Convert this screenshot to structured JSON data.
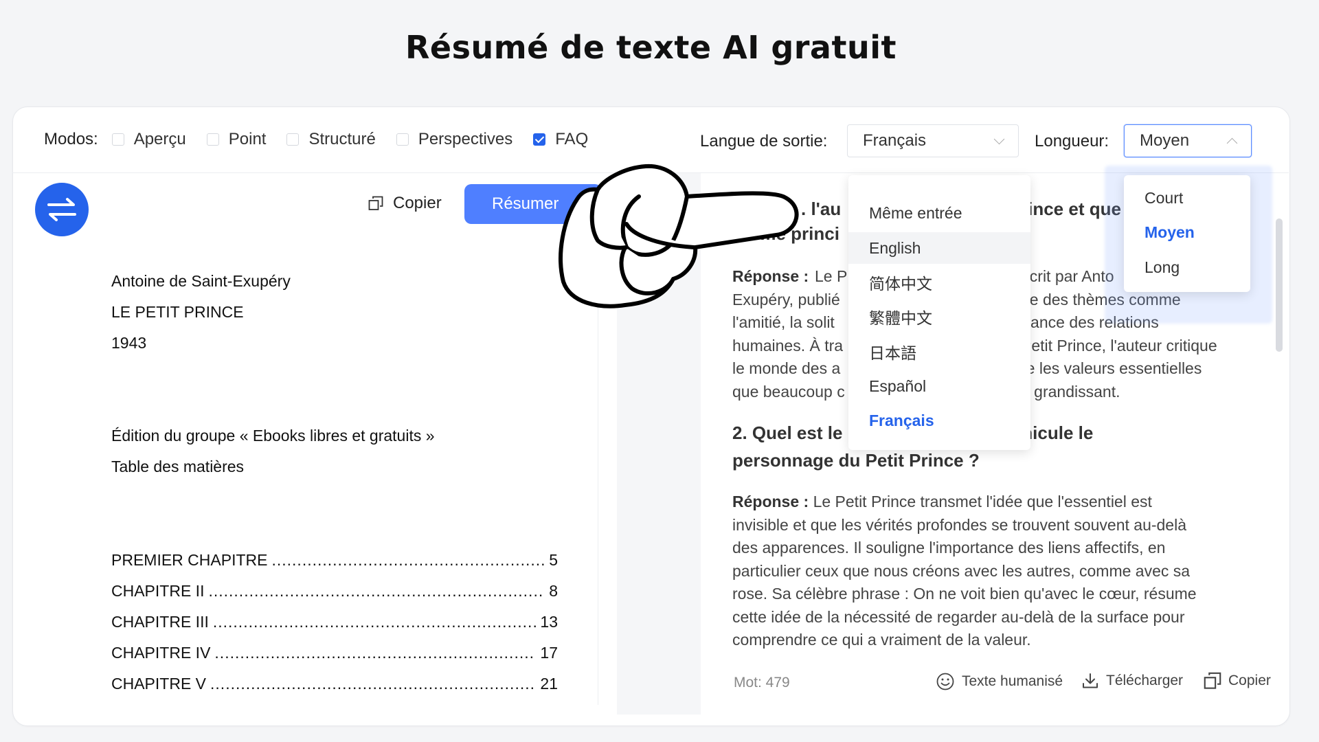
{
  "page_title": "Résumé de texte AI gratuit",
  "modes": {
    "label": "Modos:",
    "options": [
      {
        "label": "Aperçu",
        "checked": false
      },
      {
        "label": "Point",
        "checked": false
      },
      {
        "label": "Structuré",
        "checked": false
      },
      {
        "label": "Perspectives",
        "checked": false
      },
      {
        "label": "FAQ",
        "checked": true
      }
    ]
  },
  "output_language": {
    "label": "Langue de sortie:",
    "selected": "Français",
    "options": [
      "Même entrée",
      "English",
      "简体中文",
      "繁體中文",
      "日本語",
      "Español",
      "Français"
    ],
    "hovered": "English"
  },
  "length": {
    "label": "Longueur:",
    "selected": "Moyen",
    "options": [
      "Court",
      "Moyen",
      "Long"
    ]
  },
  "toolbar": {
    "copy_label": "Copier",
    "summarize_label": "Résumer"
  },
  "input_text": {
    "lines": [
      "Antoine de Saint-Exupéry",
      "LE PETIT PRINCE",
      "1943",
      "Édition du groupe « Ebooks libres et gratuits »",
      "Table des matières"
    ],
    "toc": [
      {
        "title": "PREMIER CHAPITRE",
        "page": "5"
      },
      {
        "title": "CHAPITRE II",
        "page": "8"
      },
      {
        "title": "CHAPITRE III",
        "page": "13"
      },
      {
        "title": "CHAPITRE IV",
        "page": "17"
      },
      {
        "title": "CHAPITRE V",
        "page": "21"
      }
    ]
  },
  "output": {
    "q1_partial_a": ". l'au",
    "q1_partial_b": "rince et que",
    "q1_partial_c": "neme princi",
    "a1_label": "Réponse :",
    "a1_lines": [
      [
        "Le P",
        "écrit par Anto"
      ],
      [
        "Exupéry, publié",
        "de des thèmes comme"
      ],
      [
        "l'amitié, la solit",
        "rtance des relations"
      ],
      [
        "humaines. À tra",
        "Petit Prince, l'auteur critique"
      ],
      [
        "le monde des a",
        "re les valeurs essentielles"
      ],
      [
        "que beaucoup c",
        "n grandissant."
      ]
    ],
    "q2_line1_a": "2. Quel est le",
    "q2_line1_b": "el que véhicule le",
    "q2_line2": "personnage du Petit Prince ?",
    "a2_label": "Réponse :",
    "a2_lines": [
      "Le Petit Prince transmet l'idée que l'essentiel est",
      "invisible et que les vérités profondes se trouvent souvent au-delà",
      "des apparences. Il souligne l'importance des liens affectifs, en",
      "particulier ceux que nous créons avec les autres, comme avec sa",
      "rose. Sa célèbre phrase : On ne voit bien qu'avec le cœur, résume",
      "cette idée de la nécessité de regarder au-delà de la surface pour",
      "comprendre ce qui a vraiment de la valeur."
    ]
  },
  "footer": {
    "word_count": "Mot: 479",
    "humanize_label": "Texte humanisé",
    "download_label": "Télécharger",
    "copy_label": "Copier"
  },
  "colors": {
    "accent": "#2563eb",
    "button": "#4f7fff"
  }
}
